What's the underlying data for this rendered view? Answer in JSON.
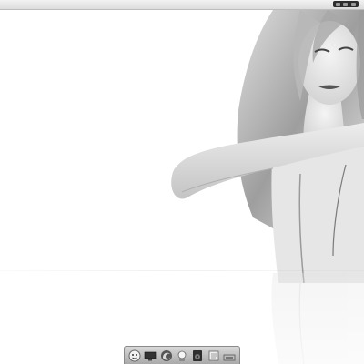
{
  "desktop": {
    "wallpaper": "woman-portrait-monochrome",
    "accent_color": "#ffffff"
  },
  "menubar": {
    "window_controls": [
      "minimize",
      "maximize",
      "close"
    ]
  },
  "dock": {
    "items": [
      {
        "icon": "finder-face-icon"
      },
      {
        "icon": "display-icon"
      },
      {
        "icon": "firefox-icon"
      },
      {
        "icon": "app-icon"
      },
      {
        "icon": "media-player-icon"
      },
      {
        "icon": "document-icon"
      },
      {
        "icon": "trash-icon"
      }
    ]
  }
}
